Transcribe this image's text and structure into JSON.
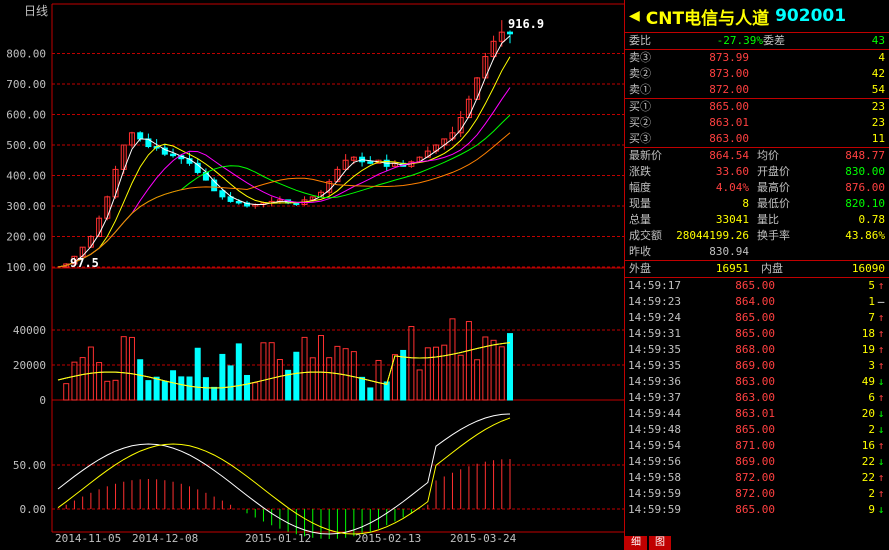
{
  "chart": {
    "period_label": "日线",
    "price_axis": [
      "800.00",
      "700.00",
      "600.00",
      "500.00",
      "400.00",
      "300.00",
      "200.00",
      "100.00"
    ],
    "price_ticks_values": [
      800,
      700,
      600,
      500,
      400,
      300,
      200,
      100
    ],
    "vol_axis": [
      "40000",
      "20000",
      "0"
    ],
    "ind_axis": [
      "50.00",
      "0.00"
    ],
    "high_label": "916.9",
    "low_label": "97.5",
    "dates": [
      "2014-11-05",
      "2014-12-08",
      "2015-01-12",
      "2015-02-13",
      "2015-03-24"
    ],
    "colors": {
      "up": "#ff3030",
      "down": "#00ffff",
      "ma1": "#ffffff",
      "ma2": "#ffff00",
      "ma3": "#ff00ff",
      "ma4": "#00ff00",
      "ma5": "#ff8000",
      "grid": "#c00000"
    }
  },
  "chart_data": {
    "type": "candlestick",
    "price_series": [
      100,
      110,
      135,
      165,
      200,
      260,
      330,
      420,
      500,
      540,
      520,
      495,
      490,
      470,
      465,
      455,
      440,
      410,
      385,
      350,
      330,
      315,
      310,
      300,
      305,
      310,
      315,
      320,
      310,
      305,
      320,
      330,
      345,
      380,
      420,
      450,
      460,
      445,
      440,
      450,
      430,
      440,
      430,
      445,
      460,
      480,
      500,
      520,
      540,
      590,
      650,
      720,
      790,
      840,
      870,
      864.54
    ],
    "high": 916.9,
    "low": 97.5
  },
  "panel": {
    "name": "CNT电信与人道",
    "code": "902001",
    "ratio_label": "委比",
    "ratio_value": "-27.39%",
    "diff_label": "委差",
    "diff_value": "43",
    "sells": [
      {
        "label": "卖③",
        "price": "873.99",
        "vol": "4"
      },
      {
        "label": "卖②",
        "price": "873.00",
        "vol": "42"
      },
      {
        "label": "卖①",
        "price": "872.00",
        "vol": "54"
      }
    ],
    "buys": [
      {
        "label": "买①",
        "price": "865.00",
        "vol": "23"
      },
      {
        "label": "买②",
        "price": "863.01",
        "vol": "23"
      },
      {
        "label": "买③",
        "price": "863.00",
        "vol": "11"
      }
    ],
    "stats": [
      {
        "l1": "最新价",
        "v1": "864.54",
        "c1": "red",
        "l2": "均价",
        "v2": "848.77",
        "c2": "red"
      },
      {
        "l1": "涨跌",
        "v1": "33.60",
        "c1": "red",
        "l2": "开盘价",
        "v2": "830.00",
        "c2": "grn"
      },
      {
        "l1": "幅度",
        "v1": "4.04%",
        "c1": "red",
        "l2": "最高价",
        "v2": "876.00",
        "c2": "red"
      },
      {
        "l1": "现量",
        "v1": "8",
        "c1": "yel",
        "l2": "最低价",
        "v2": "820.10",
        "c2": "grn"
      },
      {
        "l1": "总量",
        "v1": "33041",
        "c1": "yel",
        "l2": "量比",
        "v2": "0.78",
        "c2": "yel"
      },
      {
        "l1": "成交额",
        "v1": "28044199.26",
        "c1": "yel",
        "l2": "换手率",
        "v2": "43.86%",
        "c2": "yel"
      }
    ],
    "prev_label": "昨收",
    "prev_value": "830.94",
    "outer_label": "外盘",
    "outer_value": "16951",
    "inner_label": "内盘",
    "inner_value": "16090",
    "ticks": [
      {
        "t": "14:59:17",
        "p": "865.00",
        "v": "5",
        "d": "↑",
        "dc": "red"
      },
      {
        "t": "14:59:23",
        "p": "864.00",
        "v": "1",
        "d": "—",
        "dc": "wht"
      },
      {
        "t": "14:59:24",
        "p": "865.00",
        "v": "7",
        "d": "↑",
        "dc": "red"
      },
      {
        "t": "14:59:31",
        "p": "865.00",
        "v": "18",
        "d": "↑",
        "dc": "red"
      },
      {
        "t": "14:59:35",
        "p": "868.00",
        "v": "19",
        "d": "↑",
        "dc": "red"
      },
      {
        "t": "14:59:35",
        "p": "869.00",
        "v": "3",
        "d": "↑",
        "dc": "red"
      },
      {
        "t": "14:59:36",
        "p": "863.00",
        "v": "49",
        "d": "↓",
        "dc": "grn"
      },
      {
        "t": "14:59:37",
        "p": "863.00",
        "v": "6",
        "d": "↑",
        "dc": "red"
      },
      {
        "t": "14:59:44",
        "p": "863.01",
        "v": "20",
        "d": "↓",
        "dc": "grn"
      },
      {
        "t": "14:59:48",
        "p": "865.00",
        "v": "2",
        "d": "↓",
        "dc": "grn"
      },
      {
        "t": "14:59:54",
        "p": "871.00",
        "v": "16",
        "d": "↑",
        "dc": "red"
      },
      {
        "t": "14:59:56",
        "p": "869.00",
        "v": "22",
        "d": "↓",
        "dc": "grn"
      },
      {
        "t": "14:59:58",
        "p": "872.00",
        "v": "22",
        "d": "↑",
        "dc": "red"
      },
      {
        "t": "14:59:59",
        "p": "872.00",
        "v": "2",
        "d": "↑",
        "dc": "red"
      },
      {
        "t": "14:59:59",
        "p": "865.00",
        "v": "9",
        "d": "↓",
        "dc": "grn"
      }
    ],
    "tabs": [
      "细",
      "图"
    ]
  }
}
